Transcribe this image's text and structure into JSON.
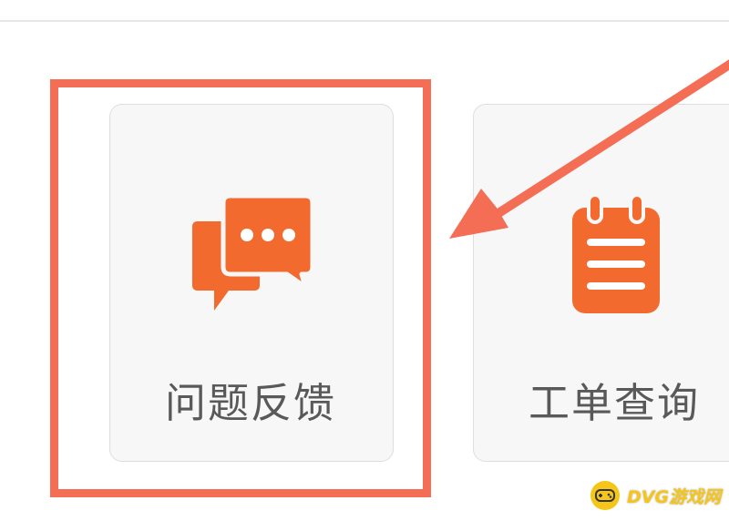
{
  "cards": [
    {
      "label": "问题反馈",
      "icon": "chat-bubbles-icon"
    },
    {
      "label": "工单查询",
      "icon": "notepad-icon"
    }
  ],
  "watermark": {
    "text": "DVG游戏网"
  },
  "colors": {
    "accent": "#f26a2e",
    "highlight": "#f46d55",
    "card_background": "#f7f7f7",
    "label_text": "#595959",
    "watermark": "#f5c518"
  }
}
